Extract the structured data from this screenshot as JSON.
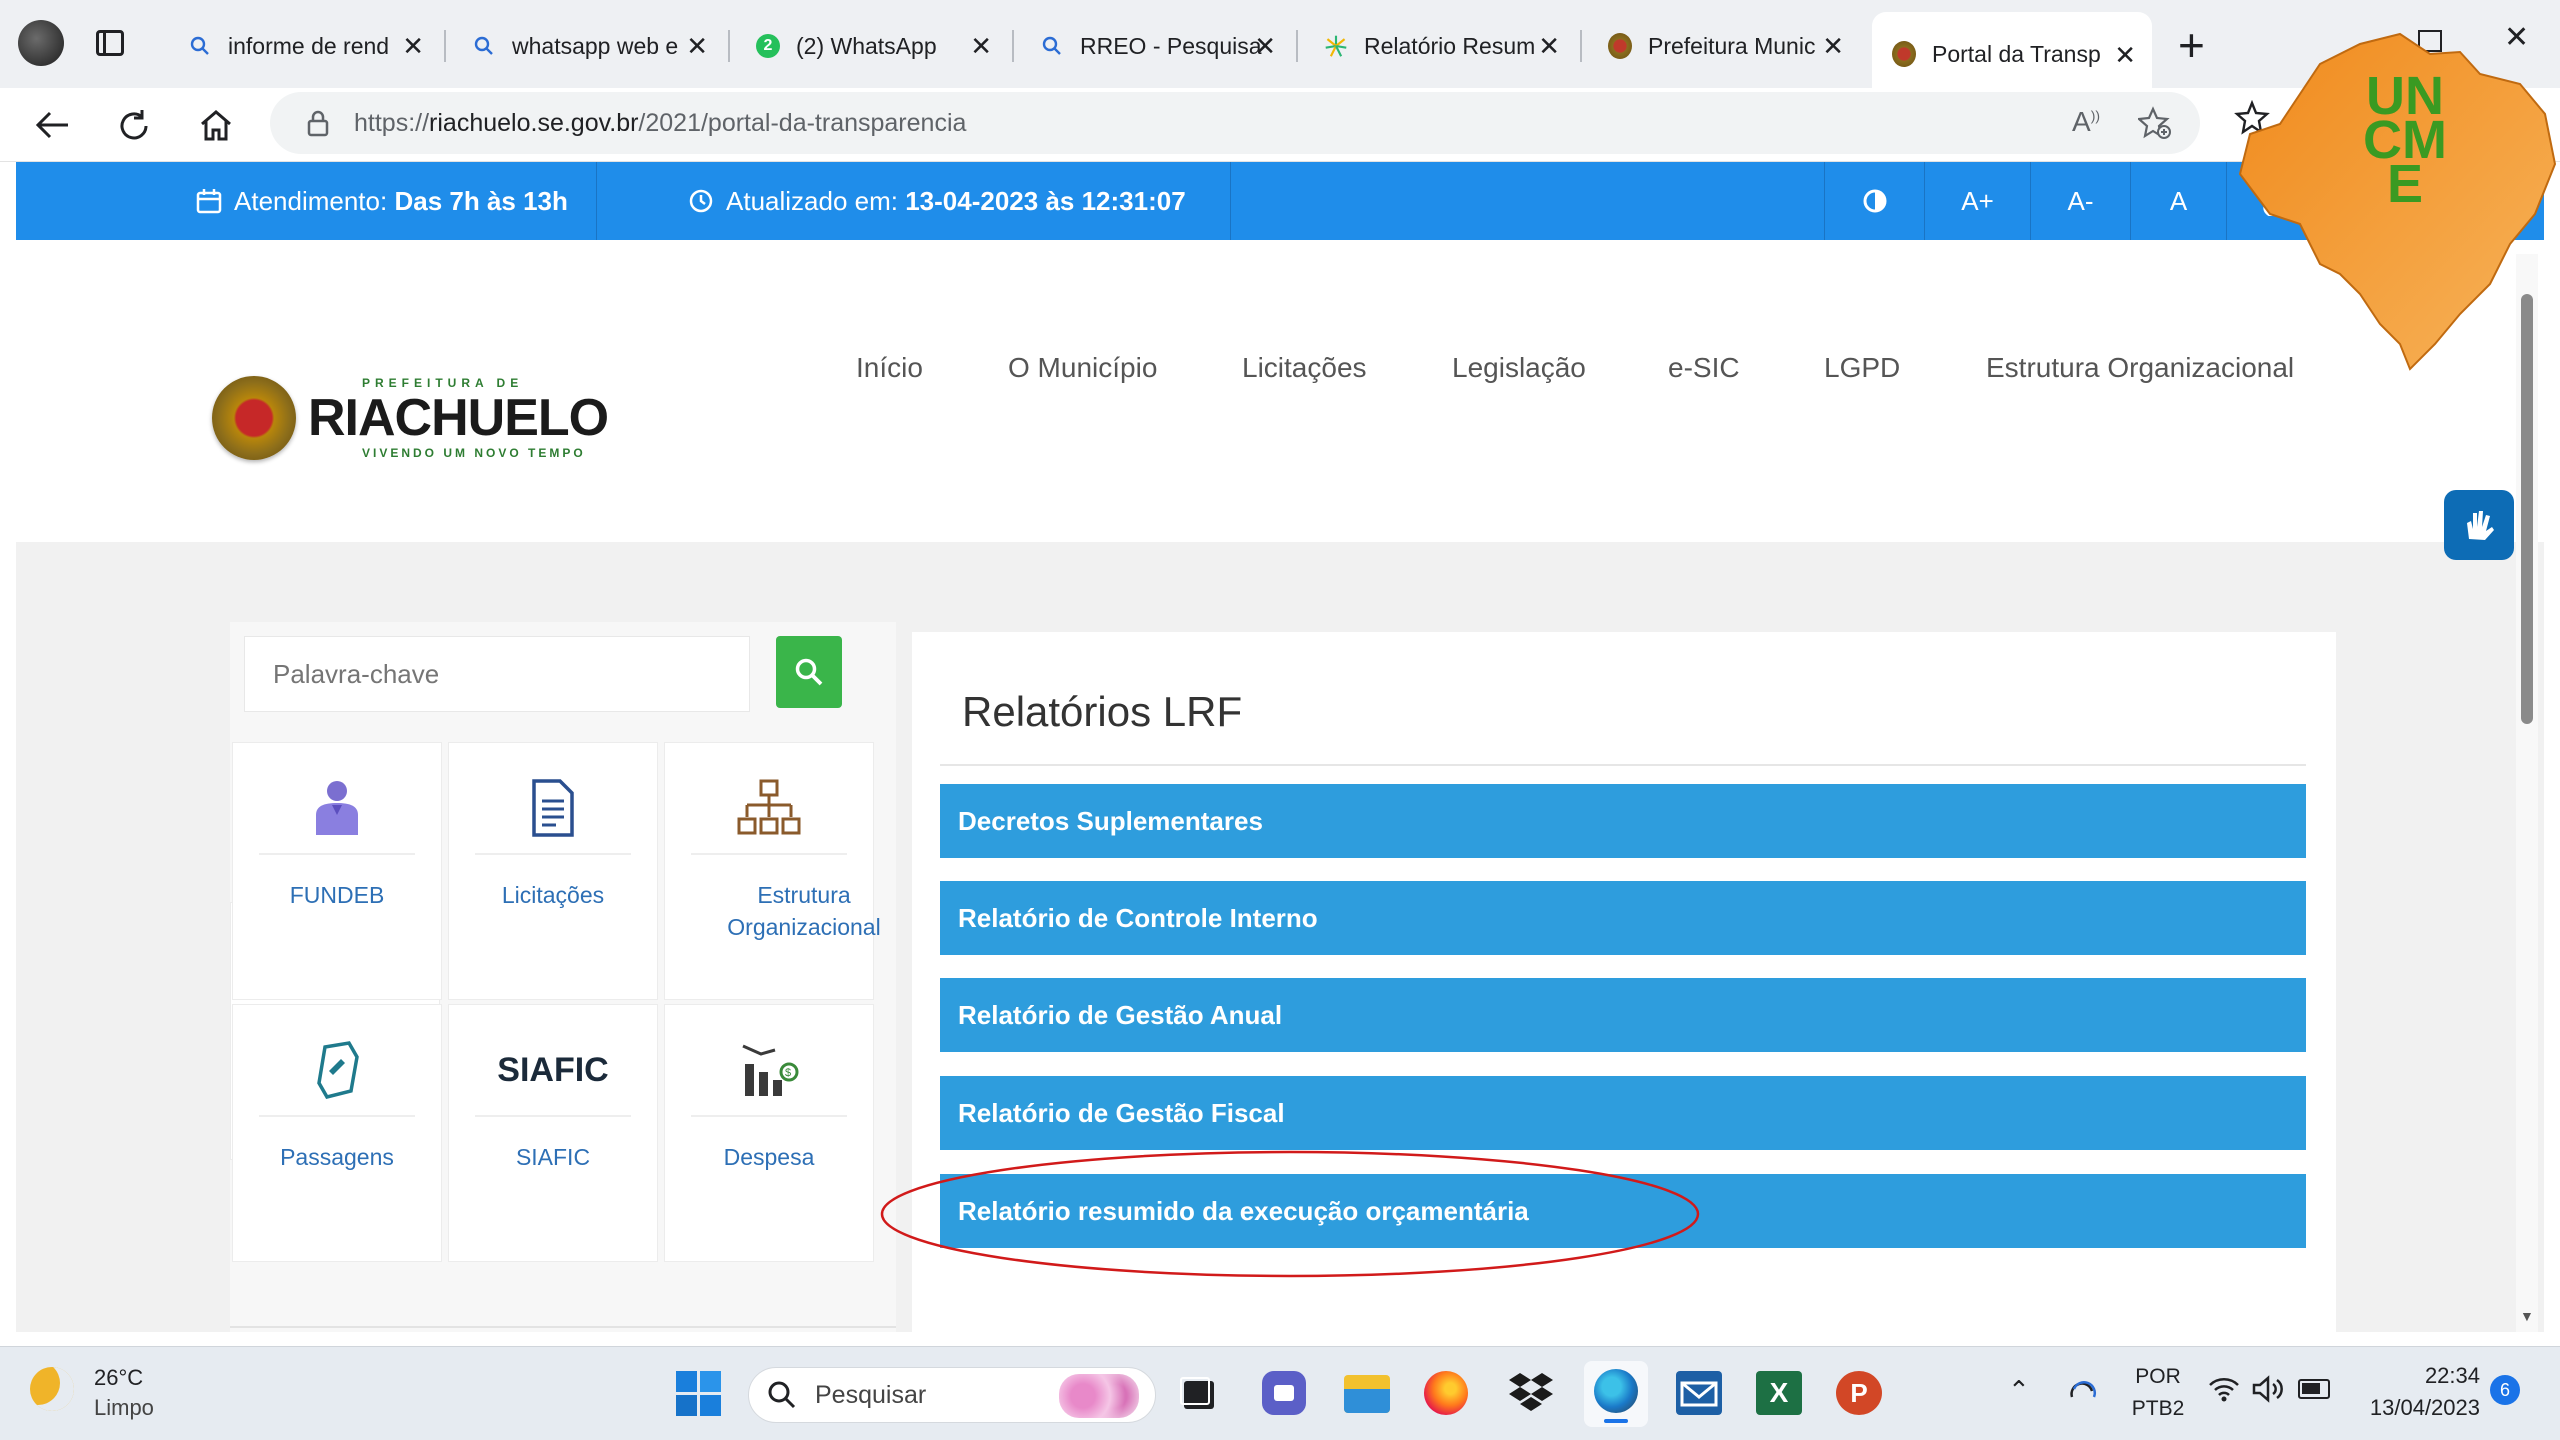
{
  "browser": {
    "tabs": [
      {
        "label": "informe de rend",
        "icon": "search-icon"
      },
      {
        "label": "whatsapp web e",
        "icon": "search-icon"
      },
      {
        "label": "(2) WhatsApp",
        "icon": "whatsapp-icon",
        "badge": "2"
      },
      {
        "label": "RREO - Pesquisa",
        "icon": "search-icon"
      },
      {
        "label": "Relatório Resum",
        "icon": "tesouro-icon"
      },
      {
        "label": "Prefeitura Munic",
        "icon": "riachuelo-favicon"
      },
      {
        "label": "Portal da Transp",
        "icon": "riachuelo-favicon",
        "active": true
      }
    ],
    "url_prefix": "https://",
    "url_host": "riachuelo.se.gov.br",
    "url_path": "/2021/portal-da-transparencia"
  },
  "topbar": {
    "atendimento_label": "Atendimento:",
    "atendimento_value": "Das 7h às 13h",
    "atualizado_label": "Atualizado em:",
    "atualizado_value": "13-04-2023 às 12:31:07",
    "font_plus": "A+",
    "font_minus": "A-",
    "font_reset": "A"
  },
  "logo": {
    "top": "PREFEITURA DE",
    "name": "RIACHUELO",
    "slogan": "VIVENDO UM NOVO TEMPO"
  },
  "watermark": {
    "text": "UNCME"
  },
  "nav": [
    "Início",
    "O Município",
    "Licitações",
    "Legislação",
    "e-SIC",
    "LGPD",
    "Estrutura Organizacional"
  ],
  "search": {
    "placeholder": "Palavra-chave"
  },
  "tiles": [
    {
      "label": "FUNDEB",
      "icon": "person-icon"
    },
    {
      "label": "Licitações",
      "icon": "document-icon"
    },
    {
      "label": "Estrutura Organizacional",
      "icon": "org-chart-icon"
    },
    {
      "label": "Passagens",
      "icon": "ticket-icon"
    },
    {
      "label": "SIAFIC",
      "icon": "siafic-logo",
      "logo_text": "SIAFIC"
    },
    {
      "label": "Despesa",
      "icon": "expense-chart-icon"
    }
  ],
  "reports": {
    "title": "Relatórios LRF",
    "items": [
      "Decretos Suplementares",
      "Relatório de Controle Interno",
      "Relatório de Gestão Anual",
      "Relatório de Gestão Fiscal",
      "Relatório resumido da execução orçamentária"
    ]
  },
  "taskbar": {
    "weather_temp": "26°C",
    "weather_desc": "Limpo",
    "search_placeholder": "Pesquisar",
    "lang": "POR",
    "layout": "PTB2",
    "time": "22:34",
    "date": "13/04/2023",
    "notifications": "6"
  },
  "colors": {
    "topbar": "#1f8dea",
    "accordion": "#2e9ddd",
    "search_button": "#3ab54a",
    "highlight_ellipse": "#d11a1a"
  }
}
